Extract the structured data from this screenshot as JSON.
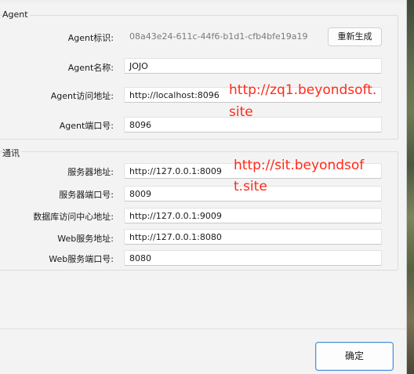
{
  "agent_group": {
    "title": "Agent",
    "fields": [
      {
        "label": "Agent标识:",
        "value": "08a43e24-611c-44f6-b1d1-cfb4bfe19a19",
        "readonly": true
      },
      {
        "label": "Agent名称:",
        "value": "JOJO"
      },
      {
        "label": "Agent访问地址:",
        "value": "http://localhost:8096"
      },
      {
        "label": "Agent端口号:",
        "value": "8096"
      }
    ],
    "regenerate_button": "重新生成"
  },
  "comm_group": {
    "title": "通讯",
    "fields": [
      {
        "label": "服务器地址:",
        "value": "http://127.0.0.1:8009"
      },
      {
        "label": "服务器端口号:",
        "value": "8009"
      },
      {
        "label": "数据库访问中心地址:",
        "value": "http://127.0.0.1:9009"
      },
      {
        "label": "Web服务地址:",
        "value": "http://127.0.0.1:8080"
      },
      {
        "label": "Web服务端口号:",
        "value": "8080"
      }
    ]
  },
  "annotations": {
    "url1_line1": "http://zq1.beyondsoft.",
    "url1_line2": "site",
    "url2_line1": "http://sit.beyondsof",
    "url2_line2": "t.site",
    "color": "#ff2a1a"
  },
  "footer": {
    "ok_button": "确定"
  }
}
